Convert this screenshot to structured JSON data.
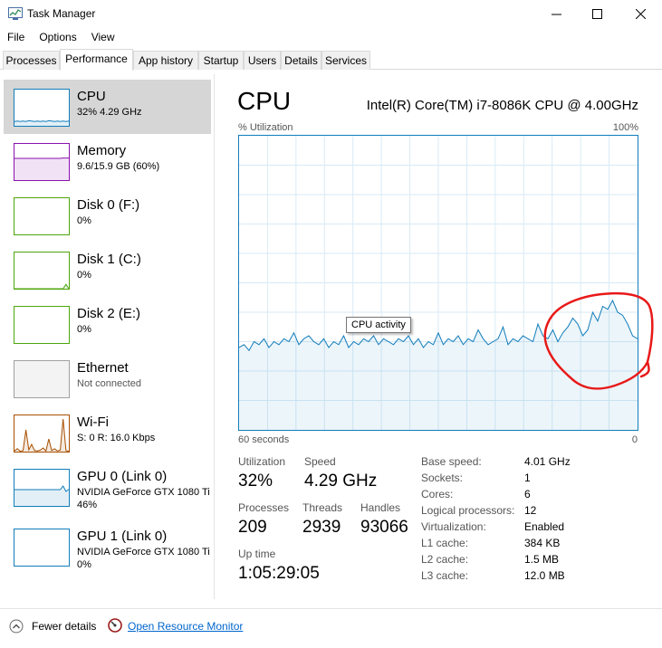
{
  "window": {
    "title": "Task Manager"
  },
  "menu": [
    "File",
    "Options",
    "View"
  ],
  "tabs": [
    "Processes",
    "Performance",
    "App history",
    "Startup",
    "Users",
    "Details",
    "Services"
  ],
  "active_tab": "Performance",
  "sidebar": [
    {
      "name": "CPU",
      "sub": "32%  4.29 GHz",
      "color": "#117dbb",
      "graph": [
        12,
        13,
        12,
        13,
        12,
        14,
        13,
        12,
        13,
        12,
        13,
        12,
        14,
        13,
        12,
        13,
        12,
        13,
        12,
        13
      ]
    },
    {
      "name": "Memory",
      "sub": "9.6/15.9 GB (60%)",
      "color": "#8b12ae",
      "graph": [
        60,
        60,
        60,
        60,
        60,
        60,
        60,
        60,
        60,
        60,
        60,
        60,
        60,
        60,
        60,
        60,
        60,
        61,
        61,
        61
      ]
    },
    {
      "name": "Disk 0 (F:)",
      "sub": "0%",
      "color": "#4da60c",
      "graph": []
    },
    {
      "name": "Disk 1 (C:)",
      "sub": "0%",
      "color": "#4da60c",
      "graph": [
        0,
        0,
        0,
        0,
        0,
        0,
        0,
        0,
        0,
        0,
        0,
        0,
        0,
        0,
        0,
        0,
        0,
        0,
        12,
        0
      ]
    },
    {
      "name": "Disk 2 (E:)",
      "sub": "0%",
      "color": "#4da60c",
      "graph": []
    },
    {
      "name": "Ethernet",
      "sub": "Not connected",
      "color": "#a0a0a0",
      "graph": []
    },
    {
      "name": "Wi-Fi",
      "sub": "S: 0  R: 16.0 Kbps",
      "color": "#a74f01",
      "graph": [
        2,
        8,
        1,
        3,
        60,
        5,
        20,
        3,
        2,
        4,
        10,
        2,
        35,
        3,
        8,
        2,
        4,
        90,
        3,
        1
      ]
    },
    {
      "name": "GPU 0 (Link 0)",
      "sub": "NVIDIA GeForce GTX 1080 Ti",
      "sub2": "46%",
      "color": "#117dbb",
      "graph": [
        45,
        45,
        45,
        45,
        45,
        45,
        45,
        45,
        45,
        45,
        45,
        45,
        45,
        45,
        45,
        45,
        45,
        55,
        40,
        46
      ]
    },
    {
      "name": "GPU 1 (Link 0)",
      "sub": "NVIDIA GeForce GTX 1080 Ti",
      "sub2": "0%",
      "color": "#117dbb",
      "graph": []
    }
  ],
  "main": {
    "title": "CPU",
    "model": "Intel(R) Core(TM) i7-8086K CPU @ 4.00GHz",
    "util_label": "% Utilization",
    "util_max": "100%",
    "x_left": "60 seconds",
    "x_right": "0",
    "tooltip": "CPU activity",
    "graph_color": "#117dbb",
    "graph_values": [
      28,
      29,
      27,
      30,
      29,
      31,
      28,
      30,
      29,
      31,
      30,
      33,
      29,
      31,
      32,
      30,
      29,
      31,
      28,
      30,
      29,
      32,
      28,
      30,
      29,
      31,
      30,
      32,
      29,
      31,
      30,
      29,
      31,
      30,
      32,
      29,
      31,
      28,
      30,
      29,
      33,
      29,
      31,
      30,
      32,
      29,
      31,
      30,
      34,
      31,
      29,
      30,
      31,
      35,
      29,
      31,
      30,
      32,
      31,
      30,
      36,
      32,
      31,
      34,
      30,
      33,
      35,
      38,
      36,
      32,
      34,
      40,
      37,
      42,
      41,
      44,
      40,
      39,
      36,
      32,
      31
    ]
  },
  "stats": {
    "utilization": {
      "label": "Utilization",
      "value": "32%"
    },
    "speed": {
      "label": "Speed",
      "value": "4.29 GHz"
    },
    "processes": {
      "label": "Processes",
      "value": "209"
    },
    "threads": {
      "label": "Threads",
      "value": "2939"
    },
    "handles": {
      "label": "Handles",
      "value": "93066"
    },
    "uptime": {
      "label": "Up time",
      "value": "1:05:29:05"
    }
  },
  "specs": [
    {
      "label": "Base speed:",
      "value": "4.01 GHz"
    },
    {
      "label": "Sockets:",
      "value": "1"
    },
    {
      "label": "Cores:",
      "value": "6"
    },
    {
      "label": "Logical processors:",
      "value": "12"
    },
    {
      "label": "Virtualization:",
      "value": "Enabled"
    },
    {
      "label": "L1 cache:",
      "value": "384 KB"
    },
    {
      "label": "L2 cache:",
      "value": "1.5 MB"
    },
    {
      "label": "L3 cache:",
      "value": "12.0 MB"
    }
  ],
  "footer": {
    "fewer": "Fewer details",
    "resource_monitor": "Open Resource Monitor"
  },
  "annotation_color": "#e81919"
}
